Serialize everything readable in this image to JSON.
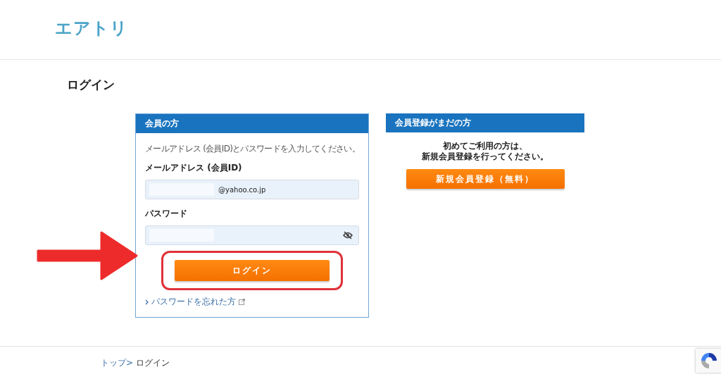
{
  "header": {
    "logo": "エアトリ"
  },
  "page_title": "ログイン",
  "member_panel": {
    "title": "会員の方",
    "instruction": "メールアドレス (会員ID)とパスワードを入力してください。",
    "email": {
      "label": "メールアドレス (会員ID)",
      "value": "@yahoo.co.jp"
    },
    "password": {
      "label": "パスワード"
    },
    "login_button": "ログイン",
    "highlighted": true,
    "forgot_link": "パスワードを忘れた方"
  },
  "register_panel": {
    "title": "会員登録がまだの方",
    "message_lines": [
      "初めてご利用の方は、",
      "新規会員登録を行ってください。"
    ],
    "register_button": "新規会員登録（無料）"
  },
  "breadcrumb": [
    {
      "label": "トップ>",
      "kind": "link"
    },
    {
      "label": "ログイン",
      "kind": "current"
    }
  ]
}
